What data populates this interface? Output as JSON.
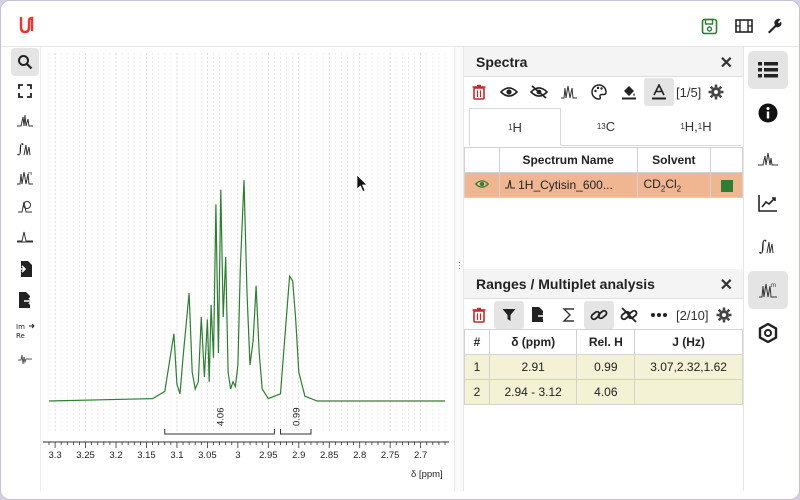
{
  "toolbar_left": {
    "items": [
      {
        "icon": "magnifier-icon",
        "active": true
      },
      {
        "icon": "fullscreen-icon"
      },
      {
        "icon": "peak-picking-icon"
      },
      {
        "icon": "integral-icon"
      },
      {
        "icon": "multiplet-icon"
      },
      {
        "icon": "phase-correction-icon"
      },
      {
        "icon": "baseline-icon"
      },
      {
        "icon": "import-icon"
      },
      {
        "icon": "export-icon"
      },
      {
        "icon": "real-imaginary-icon"
      },
      {
        "icon": "fft-icon"
      }
    ]
  },
  "plot": {
    "x_label": "δ [ppm]",
    "x_ticks": [
      "3.3",
      "3.25",
      "3.2",
      "3.15",
      "3.1",
      "3.05",
      "3",
      "2.95",
      "2.9",
      "2.85",
      "2.8",
      "2.75",
      "2.7"
    ],
    "integrals": [
      {
        "label": "4.06",
        "from": 3.12,
        "to": 2.94
      },
      {
        "label": "0.99",
        "from": 2.93,
        "to": 2.88
      }
    ]
  },
  "chart_data": {
    "type": "line",
    "xlabel": "δ [ppm]",
    "xlim": [
      3.31,
      2.66
    ],
    "x_reversed": true,
    "x_ticks": [
      3.3,
      3.25,
      3.2,
      3.15,
      3.1,
      3.05,
      3.0,
      2.95,
      2.9,
      2.85,
      2.8,
      2.75,
      2.7
    ],
    "series": [
      {
        "x": [
          3.31,
          3.14,
          3.12,
          3.105,
          3.1,
          3.095,
          3.09,
          3.08,
          3.075,
          3.07,
          3.065,
          3.06,
          3.055,
          3.05,
          3.047,
          3.044,
          3.04,
          3.036,
          3.032,
          3.028,
          3.024,
          3.02,
          3.016,
          3.012,
          3.008,
          3.004,
          3.0,
          2.996,
          2.99,
          2.985,
          2.98,
          2.975,
          2.97,
          2.965,
          2.96,
          2.95,
          2.93,
          2.92,
          2.915,
          2.91,
          2.905,
          2.9,
          2.89,
          2.87,
          2.66
        ],
        "y": [
          0.0,
          0.01,
          0.04,
          0.28,
          0.07,
          0.03,
          0.18,
          0.45,
          0.12,
          0.05,
          0.08,
          0.35,
          0.1,
          0.34,
          0.08,
          0.4,
          0.18,
          0.82,
          0.2,
          0.88,
          0.35,
          0.6,
          0.12,
          0.05,
          0.08,
          0.06,
          0.15,
          0.55,
          0.92,
          0.45,
          0.15,
          0.25,
          0.48,
          0.2,
          0.05,
          0.01,
          0.03,
          0.36,
          0.52,
          0.5,
          0.34,
          0.12,
          0.02,
          0.0,
          0.0
        ]
      }
    ]
  },
  "spectra_panel": {
    "title": "Spectra",
    "counter": "[1/5]",
    "tabs": [
      {
        "sup": "1",
        "label": "H"
      },
      {
        "sup": "13",
        "label": "C"
      },
      {
        "sup": "1",
        "label": "H,",
        "sup2": "1",
        "label2": "H"
      }
    ],
    "columns": [
      "Spectrum Name",
      "Solvent"
    ],
    "rows": [
      {
        "name": "1H_Cytisin_600...",
        "solvent_main": "CD",
        "solvent_sub1": "2",
        "solvent_mid": "Cl",
        "solvent_sub2": "2",
        "color": "#2e7d32"
      }
    ]
  },
  "ranges_panel": {
    "title": "Ranges / Multiplet analysis",
    "counter": "[2/10]",
    "columns": [
      "#",
      "δ (ppm)",
      "Rel. H",
      "J (Hz)"
    ],
    "rows": [
      {
        "n": "1",
        "delta": "2.91",
        "relh": "0.99",
        "j": "3.07,2.32,1.62"
      },
      {
        "n": "2",
        "delta": "2.94 - 3.12",
        "relh": "4.06",
        "j": ""
      }
    ]
  },
  "colors": {
    "spectrum_line": "#2e7d32",
    "selected_row": "#f0b692",
    "ranges_row": "#f3f2d4",
    "trash_red": "#c62828",
    "logo": "#e53935",
    "save_green": "#2e7d32"
  }
}
